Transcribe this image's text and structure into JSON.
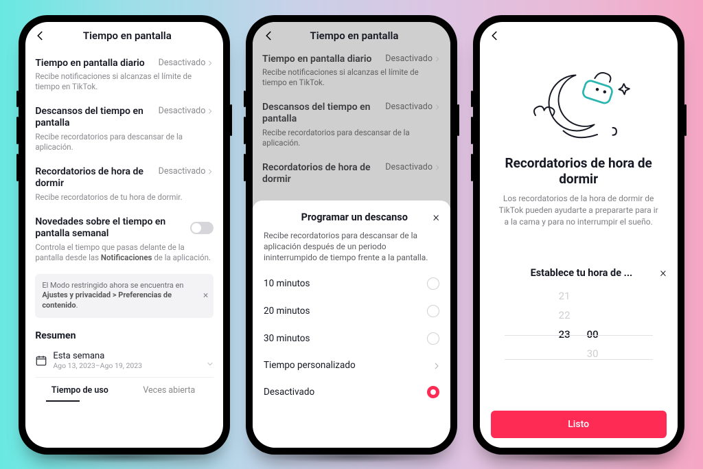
{
  "header": {
    "title": "Tiempo en pantalla"
  },
  "rows": {
    "daily": {
      "title": "Tiempo en pantalla diario",
      "status": "Desactivado",
      "desc": "Recibe notificaciones si alcanzas el límite de tiempo en TikTok."
    },
    "breaks": {
      "title": "Descansos del tiempo en pantalla",
      "status": "Desactivado",
      "desc": "Recibe recordatorios para descansar de la aplicación."
    },
    "sleep": {
      "title": "Recordatorios de hora de dormir",
      "status": "Desactivado",
      "desc": "Recibe recordatorios de tu hora de dormir."
    },
    "weekly": {
      "title": "Novedades sobre el tiempo en pantalla semanal",
      "desc_a": "Controla el tiempo que pasas delante de la pantalla desde las ",
      "desc_b": "Notificaciones",
      "desc_c": " de la aplicación."
    }
  },
  "infobox": {
    "a": "El Modo restringido ahora se encuentra en ",
    "b": "Ajustes y privacidad > Preferencias de contenido",
    "c": "."
  },
  "summary": {
    "title": "Resumen",
    "week_label": "Esta semana",
    "week_dates": "Ago 13, 2023–Ago 19, 2023",
    "tab_usage": "Tiempo de uso",
    "tab_opens": "Veces abierta"
  },
  "sheet_break": {
    "title": "Programar un descanso",
    "desc": "Recibe recordatorios para descansar de la aplicación después de un periodo ininterrumpido de tiempo frente a la pantalla.",
    "opt10": "10 minutos",
    "opt20": "20 minutos",
    "opt30": "30 minutos",
    "opt_custom": "Tiempo personalizado",
    "opt_off": "Desactivado"
  },
  "sleep_page": {
    "title": "Recordatorios de hora de dormir",
    "desc": "Los recordatorios de la hora de dormir de TikTok pueden ayudarte a prepararte para ir a la cama y para no interrumpir el sueño."
  },
  "sheet_time": {
    "title": "Establece tu hora de ...",
    "h21": "21",
    "h22": "22",
    "h23": "23",
    "m00": "00",
    "m30": "30",
    "done": "Listo"
  }
}
